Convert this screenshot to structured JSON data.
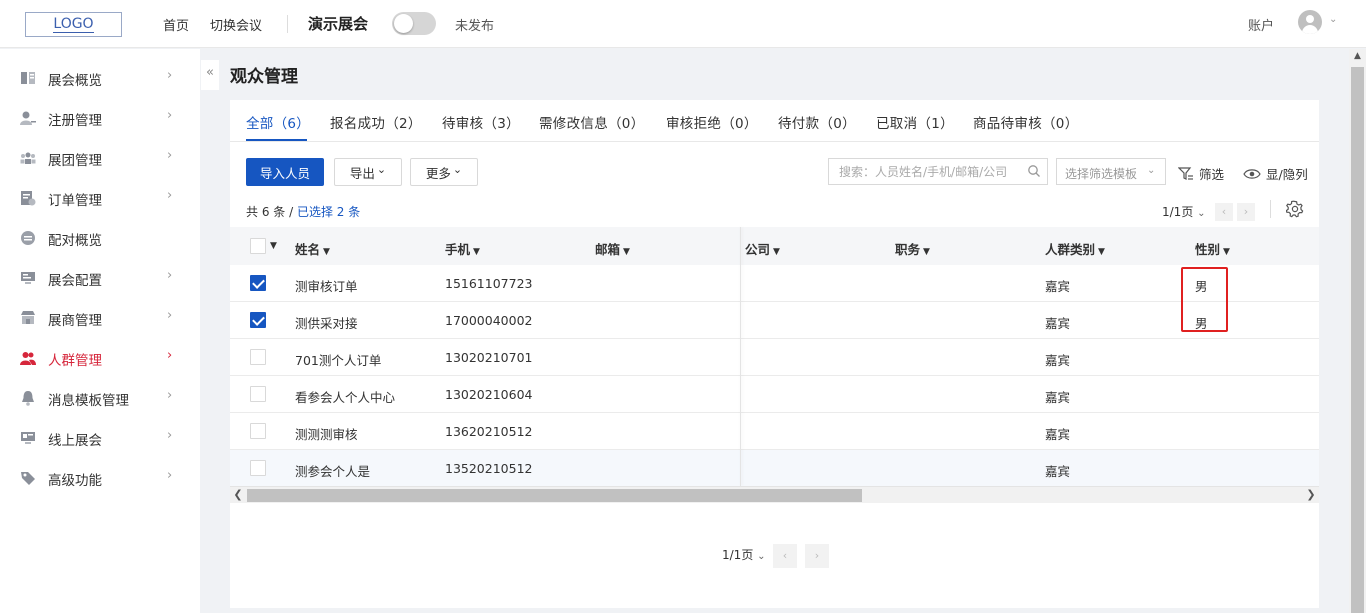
{
  "header": {
    "logo": "LOGO",
    "nav": [
      "首页",
      "切换会议"
    ],
    "meeting_name": "演示展会",
    "publish_status": "未发布",
    "account": "账户"
  },
  "sidebar": {
    "collapse_icon": "«",
    "items": [
      {
        "label": "展会概览",
        "icon": "overview-icon",
        "chevron": true
      },
      {
        "label": "注册管理",
        "icon": "register-icon",
        "chevron": true
      },
      {
        "label": "展团管理",
        "icon": "group-icon",
        "chevron": true
      },
      {
        "label": "订单管理",
        "icon": "order-icon",
        "chevron": true
      },
      {
        "label": "配对概览",
        "icon": "match-icon",
        "chevron": false
      },
      {
        "label": "展会配置",
        "icon": "config-icon",
        "chevron": true
      },
      {
        "label": "展商管理",
        "icon": "exhibitor-icon",
        "chevron": true
      },
      {
        "label": "人群管理",
        "icon": "people-icon",
        "chevron": true,
        "active": true
      },
      {
        "label": "消息模板管理",
        "icon": "bell-icon",
        "chevron": true
      },
      {
        "label": "线上展会",
        "icon": "online-icon",
        "chevron": true
      },
      {
        "label": "高级功能",
        "icon": "tag-icon",
        "chevron": true
      }
    ],
    "chevron_glyph": "›",
    "active_color": "#d6263b"
  },
  "page": {
    "title": "观众管理"
  },
  "tabs": [
    {
      "label": "全部（6）",
      "active": true
    },
    {
      "label": "报名成功（2）"
    },
    {
      "label": "待审核（3）"
    },
    {
      "label": "需修改信息（0）"
    },
    {
      "label": "审核拒绝（0）"
    },
    {
      "label": "待付款（0）"
    },
    {
      "label": "已取消（1）"
    },
    {
      "label": "商品待审核（0）"
    }
  ],
  "toolbar": {
    "import_label": "导入人员",
    "export_label": "导出",
    "more_label": "更多",
    "dropdown_glyph": "⌄",
    "search_placeholder": "搜索：人员姓名/手机/邮箱/公司",
    "template_placeholder": "选择筛选模板",
    "filter_label": "筛选",
    "columns_label": "显/隐列"
  },
  "summary": {
    "total": "共 6 条 / ",
    "selected": "已选择 2 条"
  },
  "pagination": {
    "page_label": "1/1页",
    "prev": "‹",
    "next": "›"
  },
  "table": {
    "columns": [
      "姓名",
      "手机",
      "邮箱",
      "公司",
      "职务",
      "人群类别",
      "性别"
    ],
    "sort_glyph": "▼",
    "rows": [
      {
        "checked": true,
        "name": "测审核订单",
        "phone": "15161107723",
        "email": "",
        "company": "",
        "title": "",
        "category": "嘉宾",
        "gender": "男"
      },
      {
        "checked": true,
        "name": "测供采对接",
        "phone": "17000040002",
        "email": "",
        "company": "",
        "title": "",
        "category": "嘉宾",
        "gender": "男"
      },
      {
        "checked": false,
        "name": "701测个人订单",
        "phone": "13020210701",
        "email": "",
        "company": "",
        "title": "",
        "category": "嘉宾",
        "gender": ""
      },
      {
        "checked": false,
        "name": "看参会人个人中心",
        "phone": "13020210604",
        "email": "",
        "company": "",
        "title": "",
        "category": "嘉宾",
        "gender": ""
      },
      {
        "checked": false,
        "name": "测测测审核",
        "phone": "13620210512",
        "email": "",
        "company": "",
        "title": "",
        "category": "嘉宾",
        "gender": ""
      },
      {
        "checked": false,
        "name": "测参会个人是",
        "phone": "13520210512",
        "email": "",
        "company": "",
        "title": "",
        "category": "嘉宾",
        "gender": ""
      }
    ],
    "highlight_color": "#e02020"
  },
  "colors": {
    "primary": "#1656c1",
    "background": "#f0f2f5"
  }
}
